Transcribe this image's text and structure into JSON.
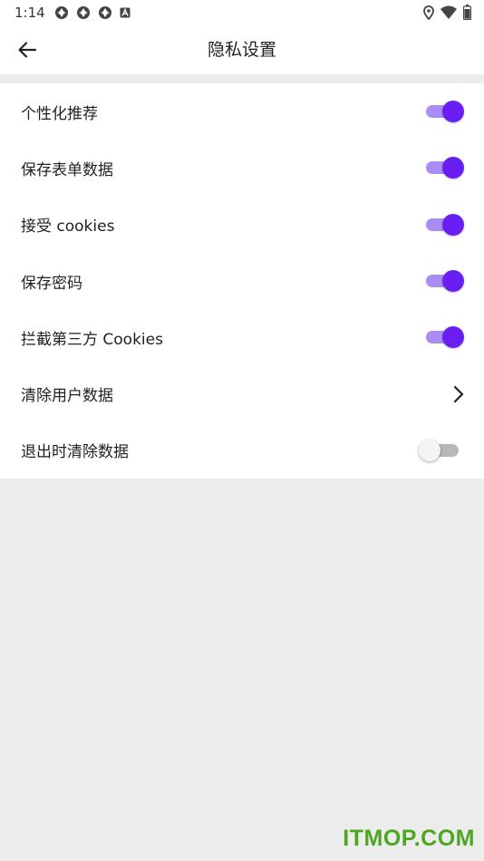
{
  "status_bar": {
    "time": "1:14",
    "left_icons": [
      "aperture-icon",
      "aperture-icon",
      "aperture-icon",
      "a-box-icon"
    ],
    "right_icons": [
      "location-icon",
      "wifi-icon",
      "battery-icon"
    ]
  },
  "app_bar": {
    "back_icon": "arrow-left-icon",
    "title": "隐私设置"
  },
  "settings": {
    "items": [
      {
        "label": "个性化推荐",
        "control": "toggle",
        "on": true
      },
      {
        "label": "保存表单数据",
        "control": "toggle",
        "on": true
      },
      {
        "label": "接受 cookies",
        "control": "toggle",
        "on": true
      },
      {
        "label": "保存密码",
        "control": "toggle",
        "on": true
      },
      {
        "label": "拦截第三方 Cookies",
        "control": "toggle",
        "on": true
      },
      {
        "label": "清除用户数据",
        "control": "chevron",
        "icon": "chevron-right-icon"
      },
      {
        "label": "退出时清除数据",
        "control": "toggle",
        "on": false
      }
    ]
  },
  "colors": {
    "accent": "#6a1ff2",
    "accent_track": "#a98df5",
    "background": "#ececec",
    "watermark": "#4ea51f"
  },
  "watermark": "ITMOP.COM"
}
